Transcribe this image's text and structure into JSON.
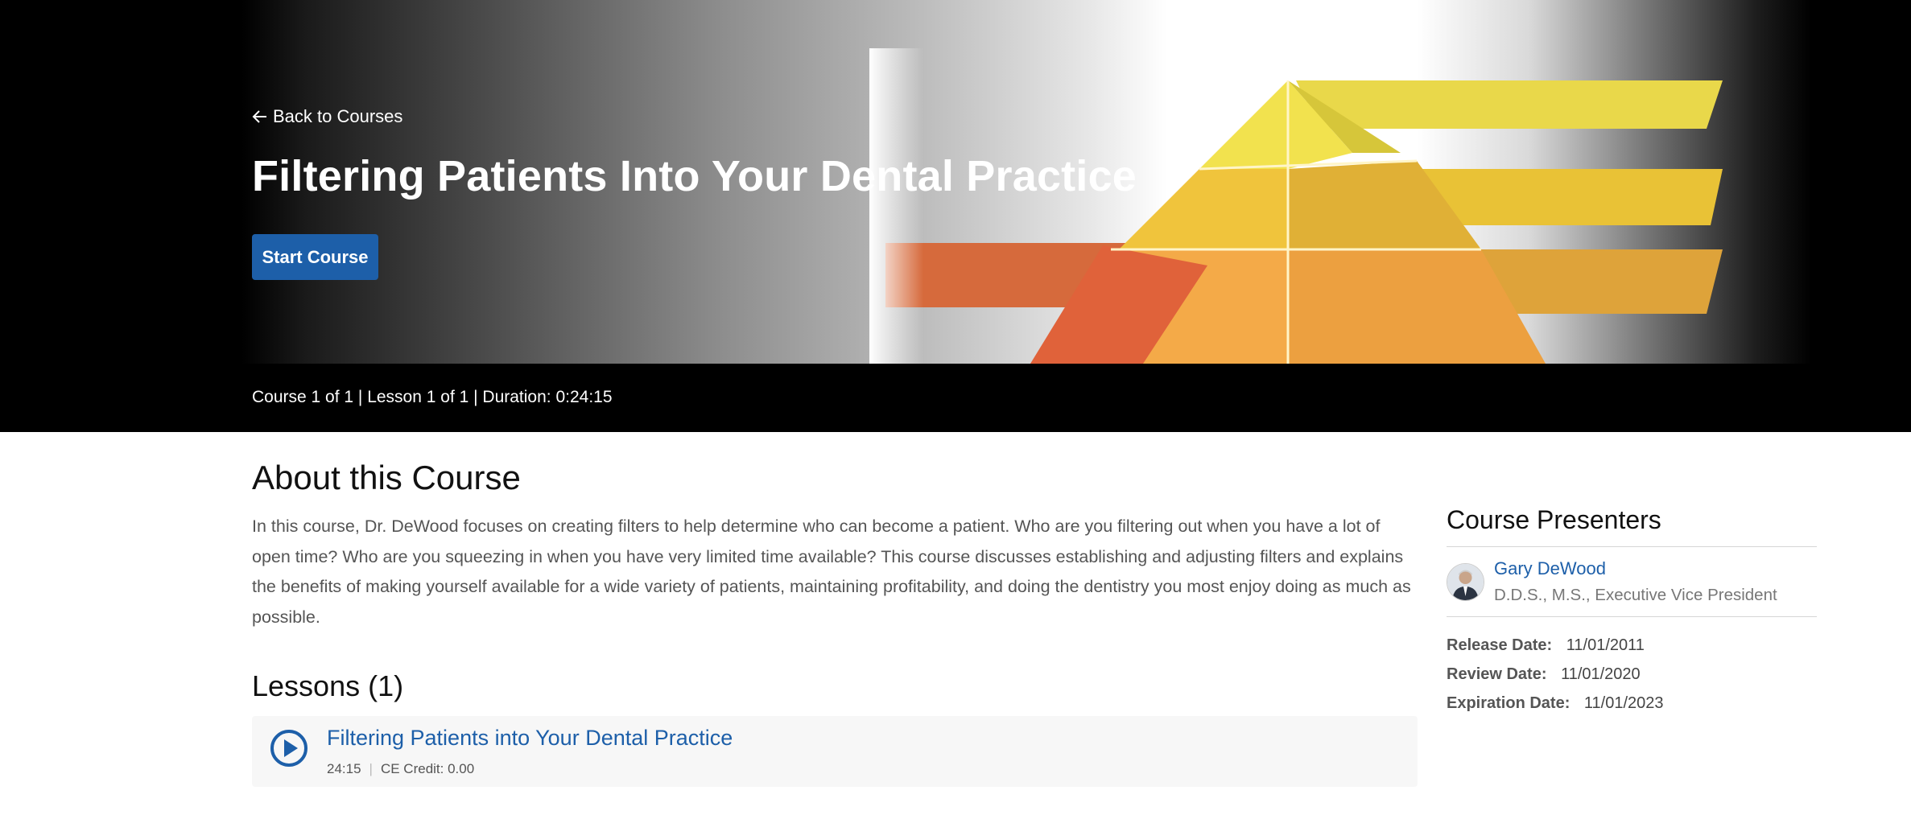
{
  "hero": {
    "back_label": "Back to Courses",
    "title": "Filtering Patients Into Your Dental Practice",
    "start_button": "Start Course",
    "meta": "Course 1 of 1 | Lesson 1 of 1 | Duration: 0:24:15"
  },
  "about": {
    "title": "About this Course",
    "description": "In this course, Dr. DeWood focuses on creating filters to help determine who can become a patient. Who are you filtering out when you have a lot of open time? Who are you squeezing in when you have very limited time available? This course discusses establishing and adjusting filters and explains the benefits of making yourself available for a wide variety of patients, maintaining profitability, and doing the dentistry you most enjoy doing as much as possible."
  },
  "lessons": {
    "title": "Lessons (1)",
    "items": [
      {
        "title": "Filtering Patients into Your Dental Practice",
        "duration": "24:15",
        "ce_credit": "CE Credit: 0.00"
      }
    ]
  },
  "sidebar": {
    "title": "Course Presenters",
    "presenters": [
      {
        "name": "Gary DeWood",
        "role": "D.D.S., M.S., Executive Vice President"
      }
    ],
    "dates": [
      {
        "label": "Release Date:",
        "value": "11/01/2011"
      },
      {
        "label": "Review Date:",
        "value": "11/01/2020"
      },
      {
        "label": "Expiration Date:",
        "value": "11/01/2023"
      }
    ]
  },
  "colors": {
    "accent": "#1d5fa9",
    "hero_bg": "#000000",
    "pyramid_yellow": "#e8c630",
    "pyramid_orange": "#e2733a"
  },
  "icons": {
    "back": "arrow-left-icon",
    "play": "play-circle-icon"
  }
}
